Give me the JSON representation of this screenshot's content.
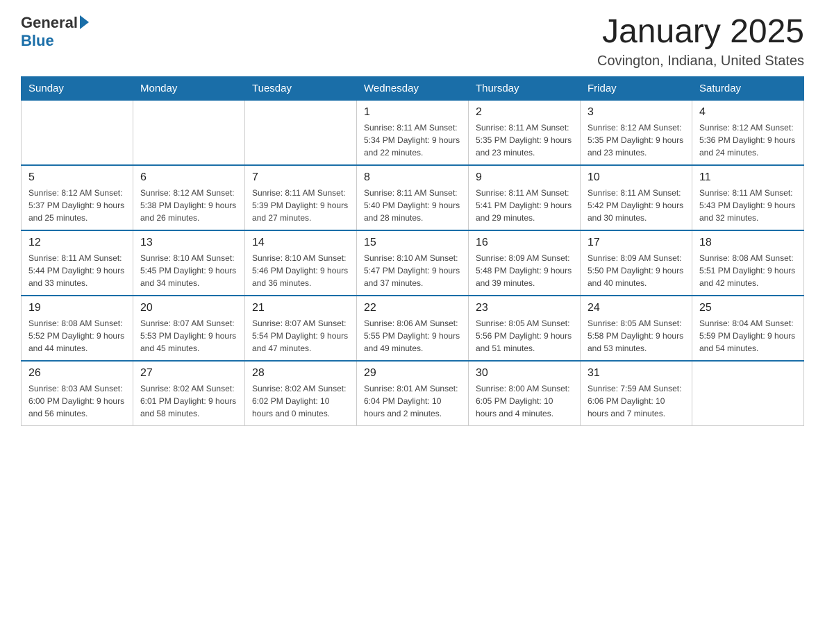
{
  "header": {
    "logo_general": "General",
    "logo_blue": "Blue",
    "title": "January 2025",
    "subtitle": "Covington, Indiana, United States"
  },
  "weekdays": [
    "Sunday",
    "Monday",
    "Tuesday",
    "Wednesday",
    "Thursday",
    "Friday",
    "Saturday"
  ],
  "weeks": [
    [
      {
        "day": "",
        "info": ""
      },
      {
        "day": "",
        "info": ""
      },
      {
        "day": "",
        "info": ""
      },
      {
        "day": "1",
        "info": "Sunrise: 8:11 AM\nSunset: 5:34 PM\nDaylight: 9 hours\nand 22 minutes."
      },
      {
        "day": "2",
        "info": "Sunrise: 8:11 AM\nSunset: 5:35 PM\nDaylight: 9 hours\nand 23 minutes."
      },
      {
        "day": "3",
        "info": "Sunrise: 8:12 AM\nSunset: 5:35 PM\nDaylight: 9 hours\nand 23 minutes."
      },
      {
        "day": "4",
        "info": "Sunrise: 8:12 AM\nSunset: 5:36 PM\nDaylight: 9 hours\nand 24 minutes."
      }
    ],
    [
      {
        "day": "5",
        "info": "Sunrise: 8:12 AM\nSunset: 5:37 PM\nDaylight: 9 hours\nand 25 minutes."
      },
      {
        "day": "6",
        "info": "Sunrise: 8:12 AM\nSunset: 5:38 PM\nDaylight: 9 hours\nand 26 minutes."
      },
      {
        "day": "7",
        "info": "Sunrise: 8:11 AM\nSunset: 5:39 PM\nDaylight: 9 hours\nand 27 minutes."
      },
      {
        "day": "8",
        "info": "Sunrise: 8:11 AM\nSunset: 5:40 PM\nDaylight: 9 hours\nand 28 minutes."
      },
      {
        "day": "9",
        "info": "Sunrise: 8:11 AM\nSunset: 5:41 PM\nDaylight: 9 hours\nand 29 minutes."
      },
      {
        "day": "10",
        "info": "Sunrise: 8:11 AM\nSunset: 5:42 PM\nDaylight: 9 hours\nand 30 minutes."
      },
      {
        "day": "11",
        "info": "Sunrise: 8:11 AM\nSunset: 5:43 PM\nDaylight: 9 hours\nand 32 minutes."
      }
    ],
    [
      {
        "day": "12",
        "info": "Sunrise: 8:11 AM\nSunset: 5:44 PM\nDaylight: 9 hours\nand 33 minutes."
      },
      {
        "day": "13",
        "info": "Sunrise: 8:10 AM\nSunset: 5:45 PM\nDaylight: 9 hours\nand 34 minutes."
      },
      {
        "day": "14",
        "info": "Sunrise: 8:10 AM\nSunset: 5:46 PM\nDaylight: 9 hours\nand 36 minutes."
      },
      {
        "day": "15",
        "info": "Sunrise: 8:10 AM\nSunset: 5:47 PM\nDaylight: 9 hours\nand 37 minutes."
      },
      {
        "day": "16",
        "info": "Sunrise: 8:09 AM\nSunset: 5:48 PM\nDaylight: 9 hours\nand 39 minutes."
      },
      {
        "day": "17",
        "info": "Sunrise: 8:09 AM\nSunset: 5:50 PM\nDaylight: 9 hours\nand 40 minutes."
      },
      {
        "day": "18",
        "info": "Sunrise: 8:08 AM\nSunset: 5:51 PM\nDaylight: 9 hours\nand 42 minutes."
      }
    ],
    [
      {
        "day": "19",
        "info": "Sunrise: 8:08 AM\nSunset: 5:52 PM\nDaylight: 9 hours\nand 44 minutes."
      },
      {
        "day": "20",
        "info": "Sunrise: 8:07 AM\nSunset: 5:53 PM\nDaylight: 9 hours\nand 45 minutes."
      },
      {
        "day": "21",
        "info": "Sunrise: 8:07 AM\nSunset: 5:54 PM\nDaylight: 9 hours\nand 47 minutes."
      },
      {
        "day": "22",
        "info": "Sunrise: 8:06 AM\nSunset: 5:55 PM\nDaylight: 9 hours\nand 49 minutes."
      },
      {
        "day": "23",
        "info": "Sunrise: 8:05 AM\nSunset: 5:56 PM\nDaylight: 9 hours\nand 51 minutes."
      },
      {
        "day": "24",
        "info": "Sunrise: 8:05 AM\nSunset: 5:58 PM\nDaylight: 9 hours\nand 53 minutes."
      },
      {
        "day": "25",
        "info": "Sunrise: 8:04 AM\nSunset: 5:59 PM\nDaylight: 9 hours\nand 54 minutes."
      }
    ],
    [
      {
        "day": "26",
        "info": "Sunrise: 8:03 AM\nSunset: 6:00 PM\nDaylight: 9 hours\nand 56 minutes."
      },
      {
        "day": "27",
        "info": "Sunrise: 8:02 AM\nSunset: 6:01 PM\nDaylight: 9 hours\nand 58 minutes."
      },
      {
        "day": "28",
        "info": "Sunrise: 8:02 AM\nSunset: 6:02 PM\nDaylight: 10 hours\nand 0 minutes."
      },
      {
        "day": "29",
        "info": "Sunrise: 8:01 AM\nSunset: 6:04 PM\nDaylight: 10 hours\nand 2 minutes."
      },
      {
        "day": "30",
        "info": "Sunrise: 8:00 AM\nSunset: 6:05 PM\nDaylight: 10 hours\nand 4 minutes."
      },
      {
        "day": "31",
        "info": "Sunrise: 7:59 AM\nSunset: 6:06 PM\nDaylight: 10 hours\nand 7 minutes."
      },
      {
        "day": "",
        "info": ""
      }
    ]
  ]
}
